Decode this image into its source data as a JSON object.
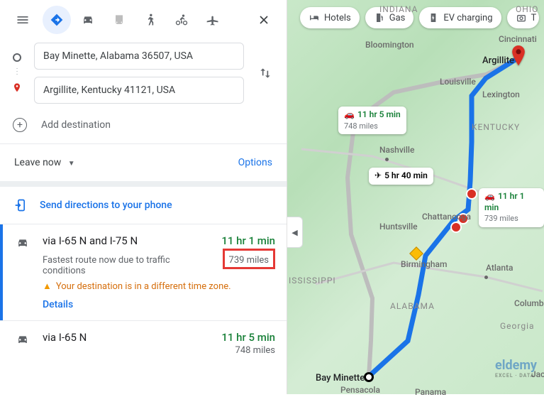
{
  "origin": "Bay Minette, Alabama 36507, USA",
  "destination": "Argillite, Kentucky 41121, USA",
  "add_destination_label": "Add destination",
  "leave_now_label": "Leave now",
  "options_label": "Options",
  "send_label": "Send directions to your phone",
  "routes": [
    {
      "via": "via I-65 N and I-75 N",
      "time": "11 hr 1 min",
      "distance": "739 miles",
      "subtitle": "Fastest route now due to traffic conditions",
      "warning": "Your destination is in a different time zone.",
      "details_label": "Details"
    },
    {
      "via": "via I-65 N",
      "time": "11 hr 5 min",
      "distance": "748 miles"
    }
  ],
  "chips": {
    "hotels": "Hotels",
    "gas": "Gas",
    "ev": "EV charging",
    "more": "T"
  },
  "map_callouts": {
    "alt1": {
      "time": "11 hr 5 min",
      "distance": "748 miles"
    },
    "flight": {
      "time": "5 hr 40 min"
    },
    "drive": {
      "time": "11 hr 1 min",
      "distance": "739 miles"
    }
  },
  "map_labels": {
    "origin_city": "Bay Minette",
    "dest_city": "Argillite",
    "atlanta": "Atlanta",
    "birmingham": "Birmingham",
    "nashville": "Nashville",
    "louisville": "Louisville",
    "lexington": "Lexington",
    "cincinnati": "Cincinnati",
    "chattanooga": "Chattanooga",
    "huntsville": "Huntsville",
    "bloomington": "Bloomington",
    "columbia": "Columbia",
    "pensacola": "Pensacola",
    "panama": "Panama",
    "indiana": "INDIANA",
    "ohio": "OHIO",
    "kentucky": "KENTUCKY",
    "alabama": "ALABAMA",
    "georgia": "Georgia",
    "mississippi": "ISSISSIPPI",
    "jac": "Jac"
  },
  "watermark": {
    "brand": "eldemy",
    "tagline": "EXCEL · DATA"
  }
}
